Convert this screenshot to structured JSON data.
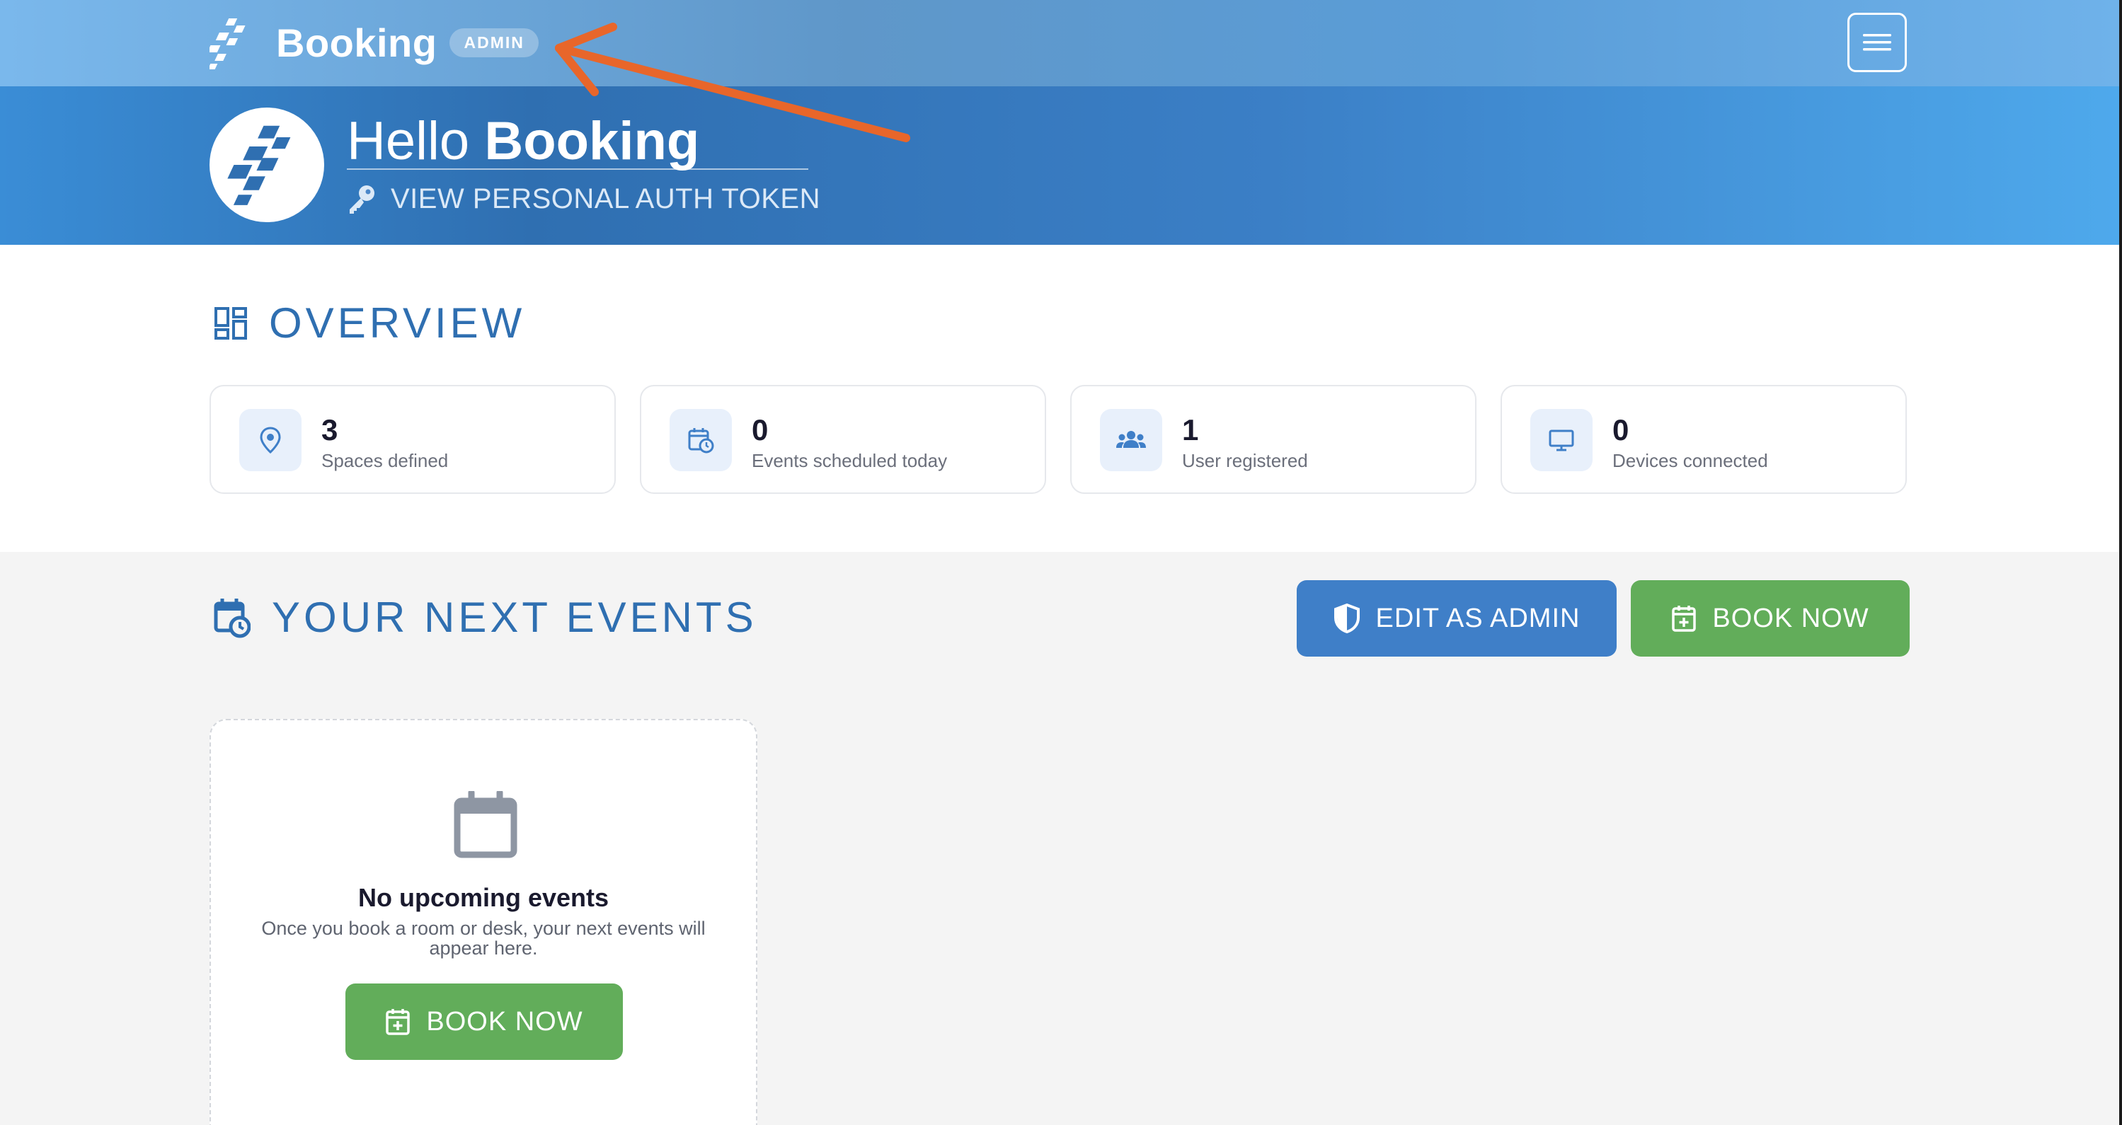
{
  "header": {
    "brand_name": "Booking",
    "badge": "ADMIN",
    "menu_icon": "hamburger-icon"
  },
  "hero": {
    "greeting": "Hello",
    "user_name": "Booking",
    "token_link": "VIEW PERSONAL AUTH TOKEN"
  },
  "overview": {
    "title": "OVERVIEW",
    "stats": [
      {
        "icon": "location-pin-icon",
        "value": "3",
        "label": "Spaces defined"
      },
      {
        "icon": "calendar-clock-icon",
        "value": "0",
        "label": "Events scheduled today"
      },
      {
        "icon": "users-icon",
        "value": "1",
        "label": "User registered"
      },
      {
        "icon": "monitor-icon",
        "value": "0",
        "label": "Devices connected"
      }
    ]
  },
  "events": {
    "title": "YOUR NEXT EVENTS",
    "edit_admin_label": "EDIT AS ADMIN",
    "book_now_label": "BOOK NOW",
    "empty": {
      "title": "No upcoming events",
      "description": "Once you book a room or desk, your next events will appear here.",
      "button_label": "BOOK NOW"
    }
  },
  "colors": {
    "primary": "#2f6fb1",
    "button_blue": "#3f7fc8",
    "button_green": "#62ad5a",
    "annotation_arrow": "#e8662a"
  }
}
